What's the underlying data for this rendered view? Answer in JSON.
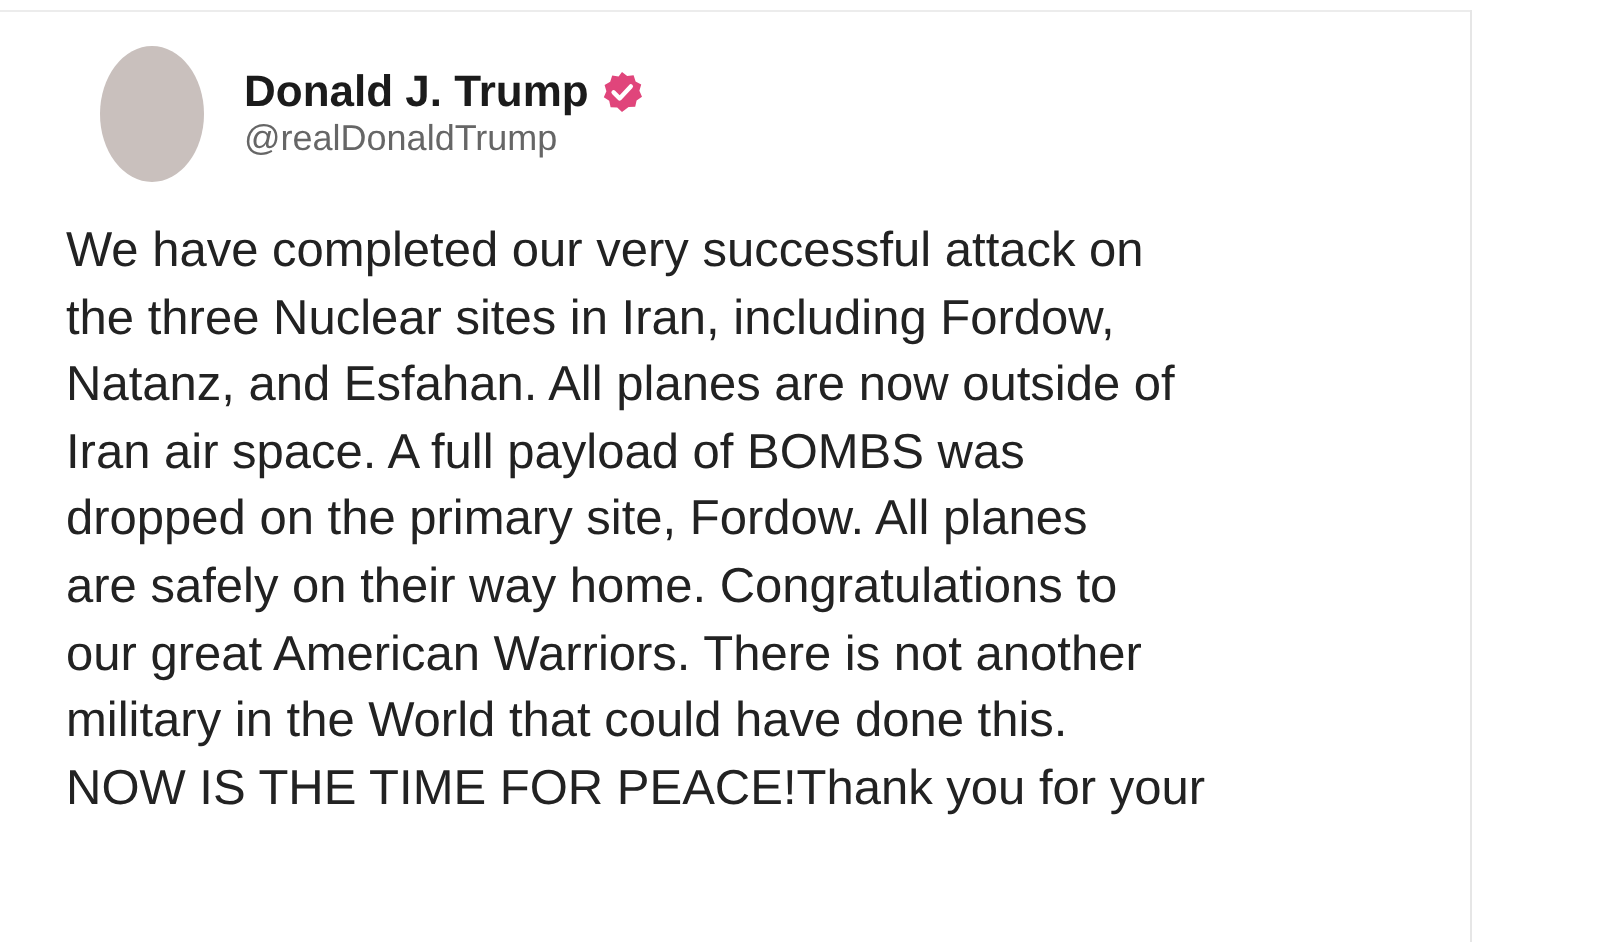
{
  "post": {
    "author": {
      "name": "Donald J. Trump",
      "handle": "@realDonaldTrump",
      "verified": true
    },
    "text": "We have completed our very successful attack on\nthe three Nuclear sites in Iran, including Fordow,\nNatanz, and Esfahan. All planes are now outside of\nIran air space. A full payload of BOMBS was\ndropped on the primary site, Fordow. All planes\nare safely on their way home. Congratulations to\nour great American Warriors. There is not another\nmilitary in the World that could have done this.\nNOW IS THE TIME FOR PEACE!Thank you for your"
  }
}
